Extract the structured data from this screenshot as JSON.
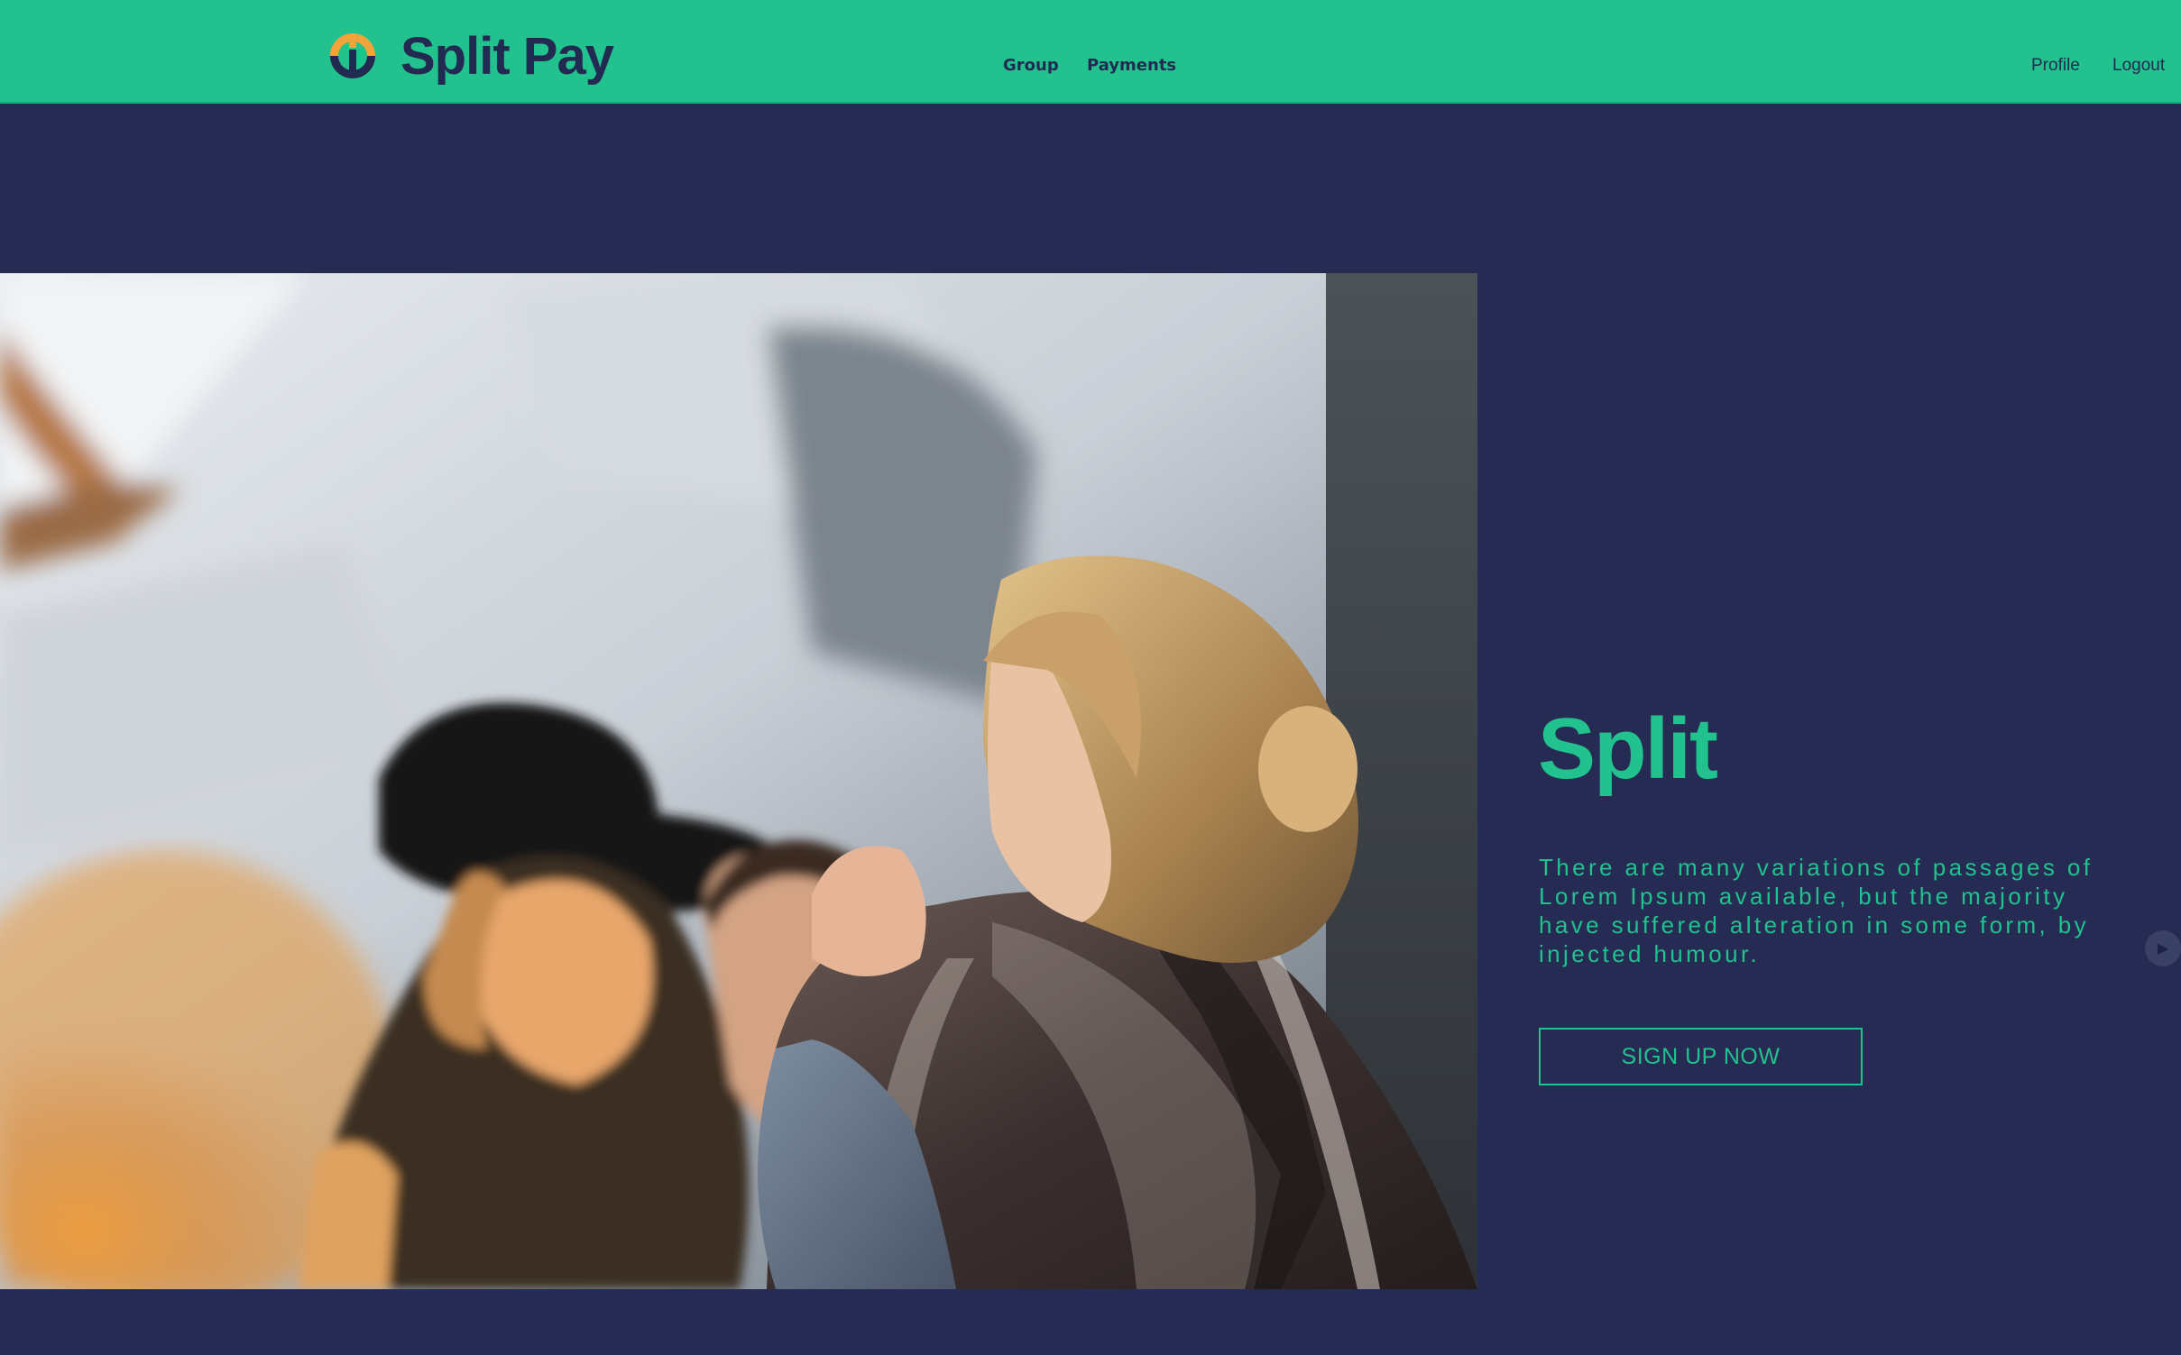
{
  "app": {
    "brand": "Split Pay",
    "colors": {
      "accent": "#21c28e",
      "background": "#252b53",
      "text_dark": "#232a52",
      "logo_orange": "#f2a33a"
    }
  },
  "navbar": {
    "links": [
      {
        "label": "Group"
      },
      {
        "label": "Payments"
      }
    ],
    "right_links": [
      {
        "label": "Profile"
      },
      {
        "label": "Logout"
      }
    ],
    "logo_icon": "split-pay-logo-icon"
  },
  "hero": {
    "image_description_icon": "photo-of-three-laughing-women",
    "title": "Split",
    "text": "There are many variations of passages of Lorem Ipsum available, but the majority have suffered alteration in some form, by injected humour.",
    "cta_label": "SIGN UP NOW",
    "carousel_next_icon": "chevron-right-icon"
  }
}
